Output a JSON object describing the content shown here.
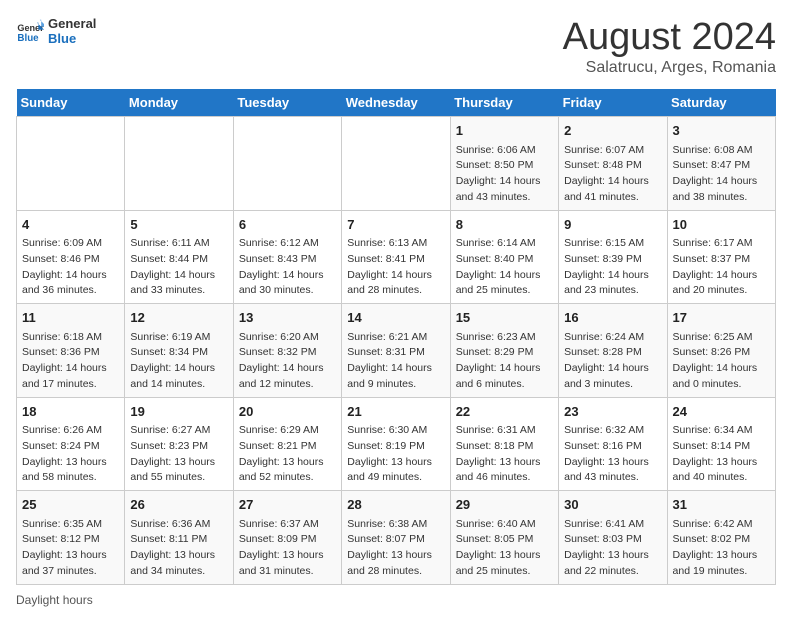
{
  "header": {
    "logo_line1": "General",
    "logo_line2": "Blue",
    "main_title": "August 2024",
    "sub_title": "Salatrucu, Arges, Romania"
  },
  "days_of_week": [
    "Sunday",
    "Monday",
    "Tuesday",
    "Wednesday",
    "Thursday",
    "Friday",
    "Saturday"
  ],
  "weeks": [
    [
      {
        "day": "",
        "info": ""
      },
      {
        "day": "",
        "info": ""
      },
      {
        "day": "",
        "info": ""
      },
      {
        "day": "",
        "info": ""
      },
      {
        "day": "1",
        "info": "Sunrise: 6:06 AM\nSunset: 8:50 PM\nDaylight: 14 hours and 43 minutes."
      },
      {
        "day": "2",
        "info": "Sunrise: 6:07 AM\nSunset: 8:48 PM\nDaylight: 14 hours and 41 minutes."
      },
      {
        "day": "3",
        "info": "Sunrise: 6:08 AM\nSunset: 8:47 PM\nDaylight: 14 hours and 38 minutes."
      }
    ],
    [
      {
        "day": "4",
        "info": "Sunrise: 6:09 AM\nSunset: 8:46 PM\nDaylight: 14 hours and 36 minutes."
      },
      {
        "day": "5",
        "info": "Sunrise: 6:11 AM\nSunset: 8:44 PM\nDaylight: 14 hours and 33 minutes."
      },
      {
        "day": "6",
        "info": "Sunrise: 6:12 AM\nSunset: 8:43 PM\nDaylight: 14 hours and 30 minutes."
      },
      {
        "day": "7",
        "info": "Sunrise: 6:13 AM\nSunset: 8:41 PM\nDaylight: 14 hours and 28 minutes."
      },
      {
        "day": "8",
        "info": "Sunrise: 6:14 AM\nSunset: 8:40 PM\nDaylight: 14 hours and 25 minutes."
      },
      {
        "day": "9",
        "info": "Sunrise: 6:15 AM\nSunset: 8:39 PM\nDaylight: 14 hours and 23 minutes."
      },
      {
        "day": "10",
        "info": "Sunrise: 6:17 AM\nSunset: 8:37 PM\nDaylight: 14 hours and 20 minutes."
      }
    ],
    [
      {
        "day": "11",
        "info": "Sunrise: 6:18 AM\nSunset: 8:36 PM\nDaylight: 14 hours and 17 minutes."
      },
      {
        "day": "12",
        "info": "Sunrise: 6:19 AM\nSunset: 8:34 PM\nDaylight: 14 hours and 14 minutes."
      },
      {
        "day": "13",
        "info": "Sunrise: 6:20 AM\nSunset: 8:32 PM\nDaylight: 14 hours and 12 minutes."
      },
      {
        "day": "14",
        "info": "Sunrise: 6:21 AM\nSunset: 8:31 PM\nDaylight: 14 hours and 9 minutes."
      },
      {
        "day": "15",
        "info": "Sunrise: 6:23 AM\nSunset: 8:29 PM\nDaylight: 14 hours and 6 minutes."
      },
      {
        "day": "16",
        "info": "Sunrise: 6:24 AM\nSunset: 8:28 PM\nDaylight: 14 hours and 3 minutes."
      },
      {
        "day": "17",
        "info": "Sunrise: 6:25 AM\nSunset: 8:26 PM\nDaylight: 14 hours and 0 minutes."
      }
    ],
    [
      {
        "day": "18",
        "info": "Sunrise: 6:26 AM\nSunset: 8:24 PM\nDaylight: 13 hours and 58 minutes."
      },
      {
        "day": "19",
        "info": "Sunrise: 6:27 AM\nSunset: 8:23 PM\nDaylight: 13 hours and 55 minutes."
      },
      {
        "day": "20",
        "info": "Sunrise: 6:29 AM\nSunset: 8:21 PM\nDaylight: 13 hours and 52 minutes."
      },
      {
        "day": "21",
        "info": "Sunrise: 6:30 AM\nSunset: 8:19 PM\nDaylight: 13 hours and 49 minutes."
      },
      {
        "day": "22",
        "info": "Sunrise: 6:31 AM\nSunset: 8:18 PM\nDaylight: 13 hours and 46 minutes."
      },
      {
        "day": "23",
        "info": "Sunrise: 6:32 AM\nSunset: 8:16 PM\nDaylight: 13 hours and 43 minutes."
      },
      {
        "day": "24",
        "info": "Sunrise: 6:34 AM\nSunset: 8:14 PM\nDaylight: 13 hours and 40 minutes."
      }
    ],
    [
      {
        "day": "25",
        "info": "Sunrise: 6:35 AM\nSunset: 8:12 PM\nDaylight: 13 hours and 37 minutes."
      },
      {
        "day": "26",
        "info": "Sunrise: 6:36 AM\nSunset: 8:11 PM\nDaylight: 13 hours and 34 minutes."
      },
      {
        "day": "27",
        "info": "Sunrise: 6:37 AM\nSunset: 8:09 PM\nDaylight: 13 hours and 31 minutes."
      },
      {
        "day": "28",
        "info": "Sunrise: 6:38 AM\nSunset: 8:07 PM\nDaylight: 13 hours and 28 minutes."
      },
      {
        "day": "29",
        "info": "Sunrise: 6:40 AM\nSunset: 8:05 PM\nDaylight: 13 hours and 25 minutes."
      },
      {
        "day": "30",
        "info": "Sunrise: 6:41 AM\nSunset: 8:03 PM\nDaylight: 13 hours and 22 minutes."
      },
      {
        "day": "31",
        "info": "Sunrise: 6:42 AM\nSunset: 8:02 PM\nDaylight: 13 hours and 19 minutes."
      }
    ]
  ],
  "footer": {
    "note": "Daylight hours"
  }
}
